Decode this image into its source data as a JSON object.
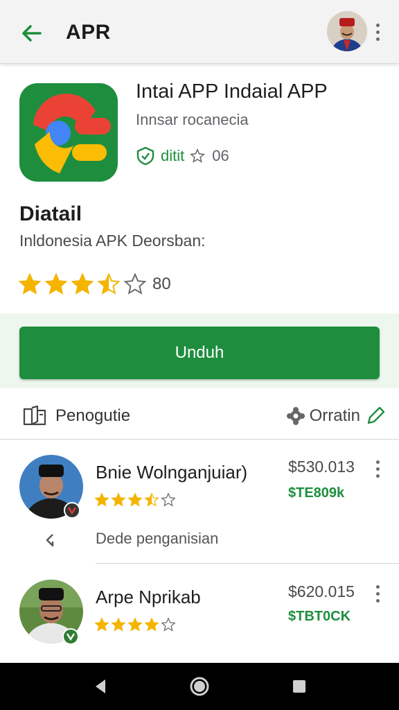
{
  "appbar": {
    "title": "APR",
    "back_icon": "arrow-left-icon",
    "menu_icon": "more-vert-icon"
  },
  "app": {
    "title": "Intai APP Indaial APP",
    "subtitle": "Innsar rocanecia",
    "verified_label": "ditit",
    "verified_count": "06",
    "verified_icon": "shield-check-icon"
  },
  "detail": {
    "title": "Diatail",
    "subtitle": "Inldonesia APK Deorsban:",
    "rating_count": "80",
    "rating": 3.5
  },
  "install": {
    "label": "Unduh"
  },
  "tabs": {
    "left_label": "Penogutie",
    "right_label": "Orratin"
  },
  "reviews": [
    {
      "name": "Bnie Wolnganjuiar)",
      "price": "$530.013",
      "sub": "$TE809k",
      "rating": 3.5,
      "reply": "Dede penganisian"
    },
    {
      "name": "Arpe Nprikab",
      "price": "$620.015",
      "sub": "$TBT0CK",
      "rating": 4
    }
  ],
  "colors": {
    "accent_green": "#1e8e3e",
    "star": "#f4b400",
    "install_band": "#eef7ee"
  }
}
